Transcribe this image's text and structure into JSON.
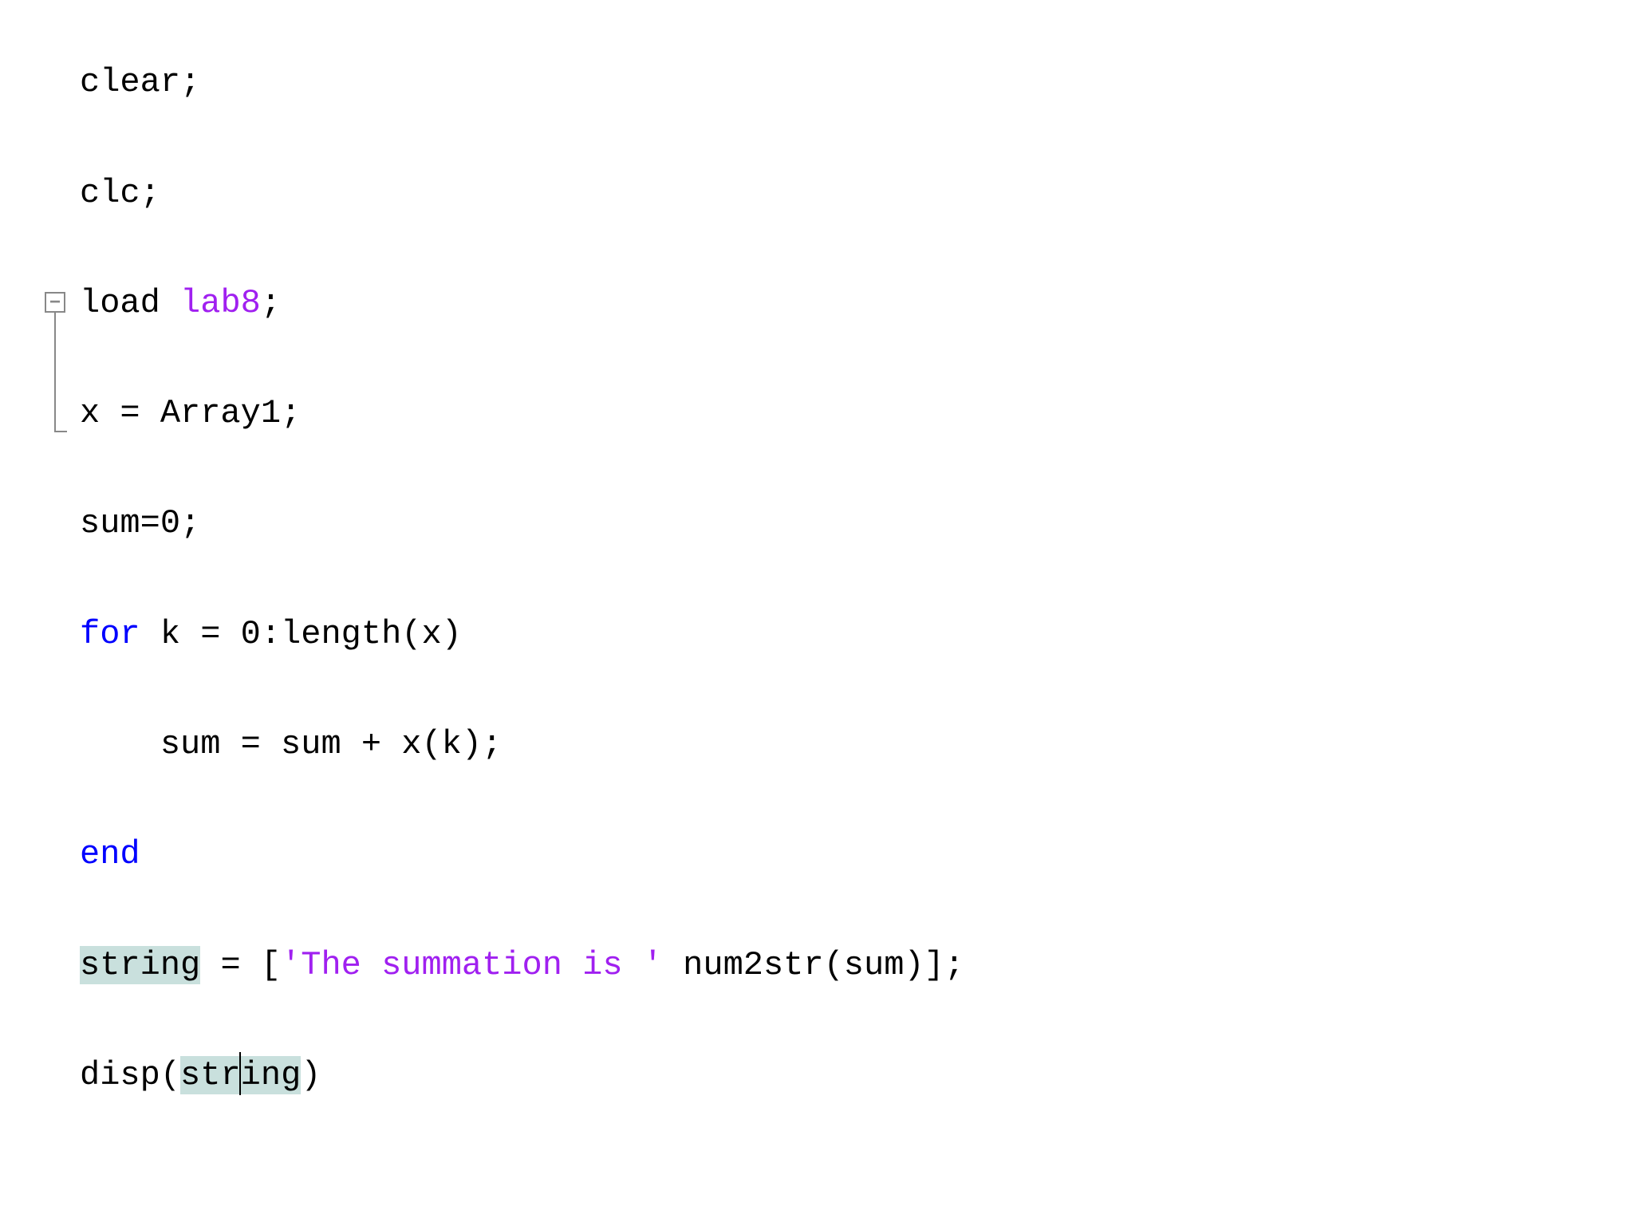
{
  "code": {
    "line1": {
      "clear": "clear",
      "semi": ";"
    },
    "line2": {
      "clc": "clc",
      "semi": ";"
    },
    "line3": {
      "load": "load",
      "space": " ",
      "lab8": "lab8",
      "semi": ";"
    },
    "line4": {
      "text": "x = Array1;"
    },
    "line5": {
      "text": "sum=0;"
    },
    "line6": {
      "for": "for",
      "rest": " k = 0:length(x)"
    },
    "line7": {
      "text": "    sum = sum + x(k);"
    },
    "line8": {
      "end": "end"
    },
    "line9": {
      "string_hl": "string",
      "eq_bracket": " = [",
      "strlit": "'The summation is '",
      "rest": " num2str(sum)];"
    },
    "line10": {
      "disp_open": "disp(",
      "str_hl": "str",
      "ing_hl": "ing",
      "close": ")"
    }
  },
  "fold_icon": "−"
}
